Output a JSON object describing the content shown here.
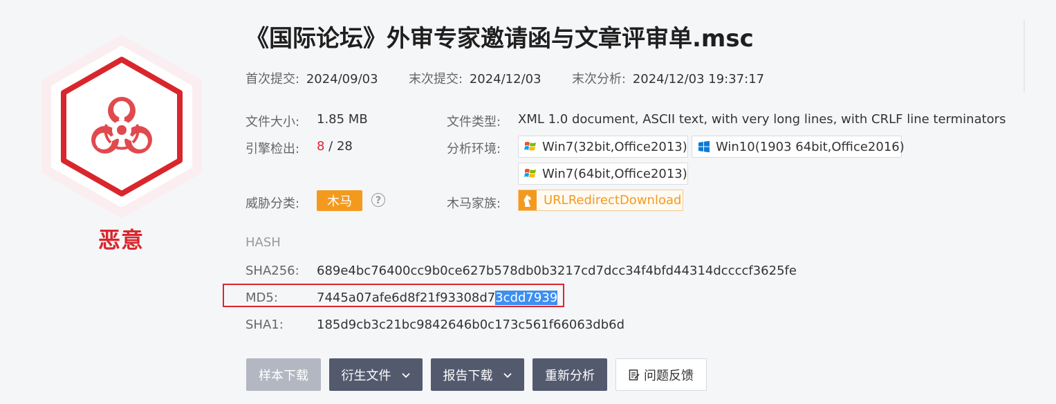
{
  "file": {
    "title": "《国际论坛》外审专家邀请函与文章评审单.msc",
    "verdict": "恶意"
  },
  "dates": {
    "first_submit_label": "首次提交:",
    "first_submit_value": "2024/09/03",
    "last_submit_label": "末次提交:",
    "last_submit_value": "2024/12/03",
    "last_analysis_label": "末次分析:",
    "last_analysis_value": "2024/12/03 19:37:17"
  },
  "info": {
    "size_label": "文件大小:",
    "size_value": "1.85 MB",
    "engine_label": "引擎检出:",
    "engine_detected": "8",
    "engine_sep": " / ",
    "engine_total": "28",
    "threat_label": "威胁分类:",
    "threat_tag": "木马",
    "help_glyph": "?",
    "type_label": "文件类型:",
    "type_value": "XML 1.0 document, ASCII text, with very long lines, with CRLF line terminators",
    "env_label": "分析环境:",
    "environments": [
      "Win7(32bit,Office2013)",
      "Win10(1903 64bit,Office2016)",
      "Win7(64bit,Office2013)"
    ],
    "family_label": "木马家族:",
    "family_value": "URLRedirectDownload"
  },
  "hash": {
    "section_title": "HASH",
    "sha256_label": "SHA256:",
    "sha256_value": "689e4bc76400cc9b0ce627b578db0b3217cd7dcc34f4bfd44314dccccf3625fe",
    "md5_label": "MD5:",
    "md5_value_plain": "7445a07afe6d8f21f93308d7",
    "md5_value_selected": "3cdd7939",
    "sha1_label": "SHA1:",
    "sha1_value": "185d9cb3c21bc9842646b0c173c561f66063db6d"
  },
  "actions": {
    "sample_download": "样本下载",
    "derived_files": "衍生文件",
    "report_download": "报告下载",
    "reanalyze": "重新分析",
    "feedback": "问题反馈"
  },
  "colors": {
    "malicious_red": "#d9262c",
    "trojan_orange": "#f39a1e",
    "selection_blue": "#3d8ff0",
    "button_dark": "#545a6e"
  }
}
